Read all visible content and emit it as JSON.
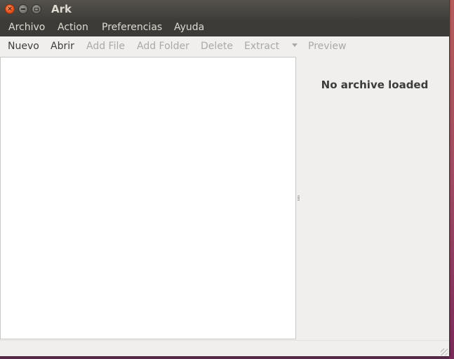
{
  "window": {
    "title": "Ark",
    "close_glyph": "×"
  },
  "menubar": {
    "items": [
      {
        "label": "Archivo"
      },
      {
        "label": "Action"
      },
      {
        "label": "Preferencias"
      },
      {
        "label": "Ayuda"
      }
    ]
  },
  "toolbar": {
    "items": [
      {
        "label": "Nuevo",
        "enabled": true
      },
      {
        "label": "Abrir",
        "enabled": true
      },
      {
        "label": "Add File",
        "enabled": false
      },
      {
        "label": "Add Folder",
        "enabled": false
      },
      {
        "label": "Delete",
        "enabled": false
      },
      {
        "label": "Extract",
        "enabled": false
      },
      {
        "label": "Preview",
        "enabled": false
      }
    ],
    "extract_dropdown_icon": "chevron-down-icon"
  },
  "info_panel": {
    "message": "No archive loaded"
  },
  "colors": {
    "titlebar": "#3c3b37",
    "window_bg": "#f0efed",
    "close_button": "#e9541e",
    "disabled_text": "#a9a9a9"
  }
}
